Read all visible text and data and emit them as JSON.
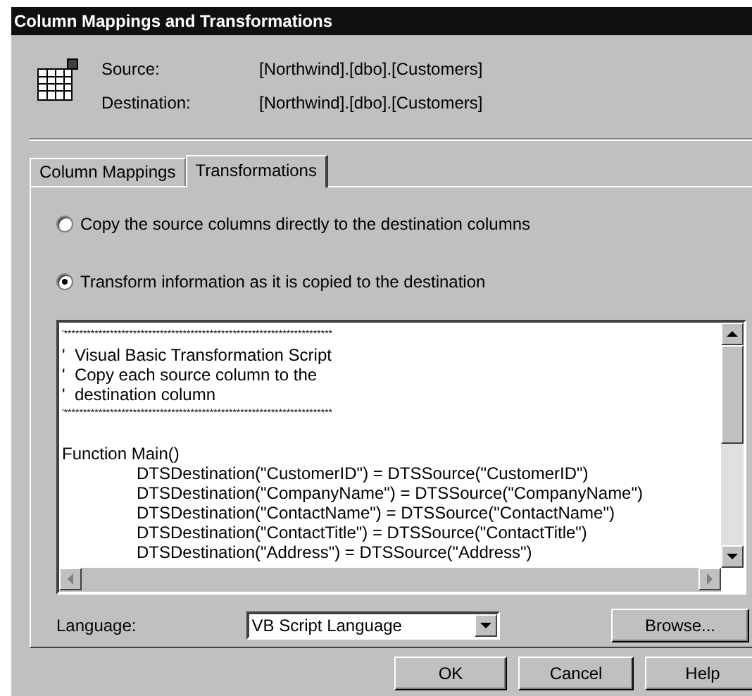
{
  "window": {
    "title": "Column Mappings and Transformations"
  },
  "header": {
    "rows": [
      {
        "label": "Source:",
        "value": "[Northwind].[dbo].[Customers]"
      },
      {
        "label": "Destination:",
        "value": "[Northwind].[dbo].[Customers]"
      }
    ]
  },
  "tabs": [
    {
      "label": "Column Mappings",
      "selected": false
    },
    {
      "label": "Transformations",
      "selected": true
    }
  ],
  "options": [
    {
      "label": "Copy the source columns directly to the destination columns",
      "selected": false
    },
    {
      "label": "Transform information as it is copied to the destination",
      "selected": true
    }
  ],
  "script": {
    "lines": [
      {
        "kind": "stars",
        "text": "'**********************************************************************"
      },
      {
        "kind": "plain",
        "text": "'  Visual Basic Transformation Script"
      },
      {
        "kind": "plain",
        "text": "'  Copy each source column to the"
      },
      {
        "kind": "plain",
        "text": "'  destination column"
      },
      {
        "kind": "stars",
        "text": "'**********************************************************************"
      },
      {
        "kind": "blank"
      },
      {
        "kind": "plain",
        "text": "Function Main()"
      },
      {
        "kind": "indented",
        "text": "DTSDestination(\"CustomerID\") = DTSSource(\"CustomerID\")"
      },
      {
        "kind": "indented",
        "text": "DTSDestination(\"CompanyName\") = DTSSource(\"CompanyName\")"
      },
      {
        "kind": "indented",
        "text": "DTSDestination(\"ContactName\") = DTSSource(\"ContactName\")"
      },
      {
        "kind": "indented",
        "text": "DTSDestination(\"ContactTitle\") = DTSSource(\"ContactTitle\")"
      },
      {
        "kind": "indented",
        "text": "DTSDestination(\"Address\") = DTSSource(\"Address\")"
      }
    ]
  },
  "language": {
    "label": "Language:",
    "value": "VB Script Language",
    "browse": "Browse..."
  },
  "buttons": [
    "OK",
    "Cancel",
    "Help"
  ]
}
